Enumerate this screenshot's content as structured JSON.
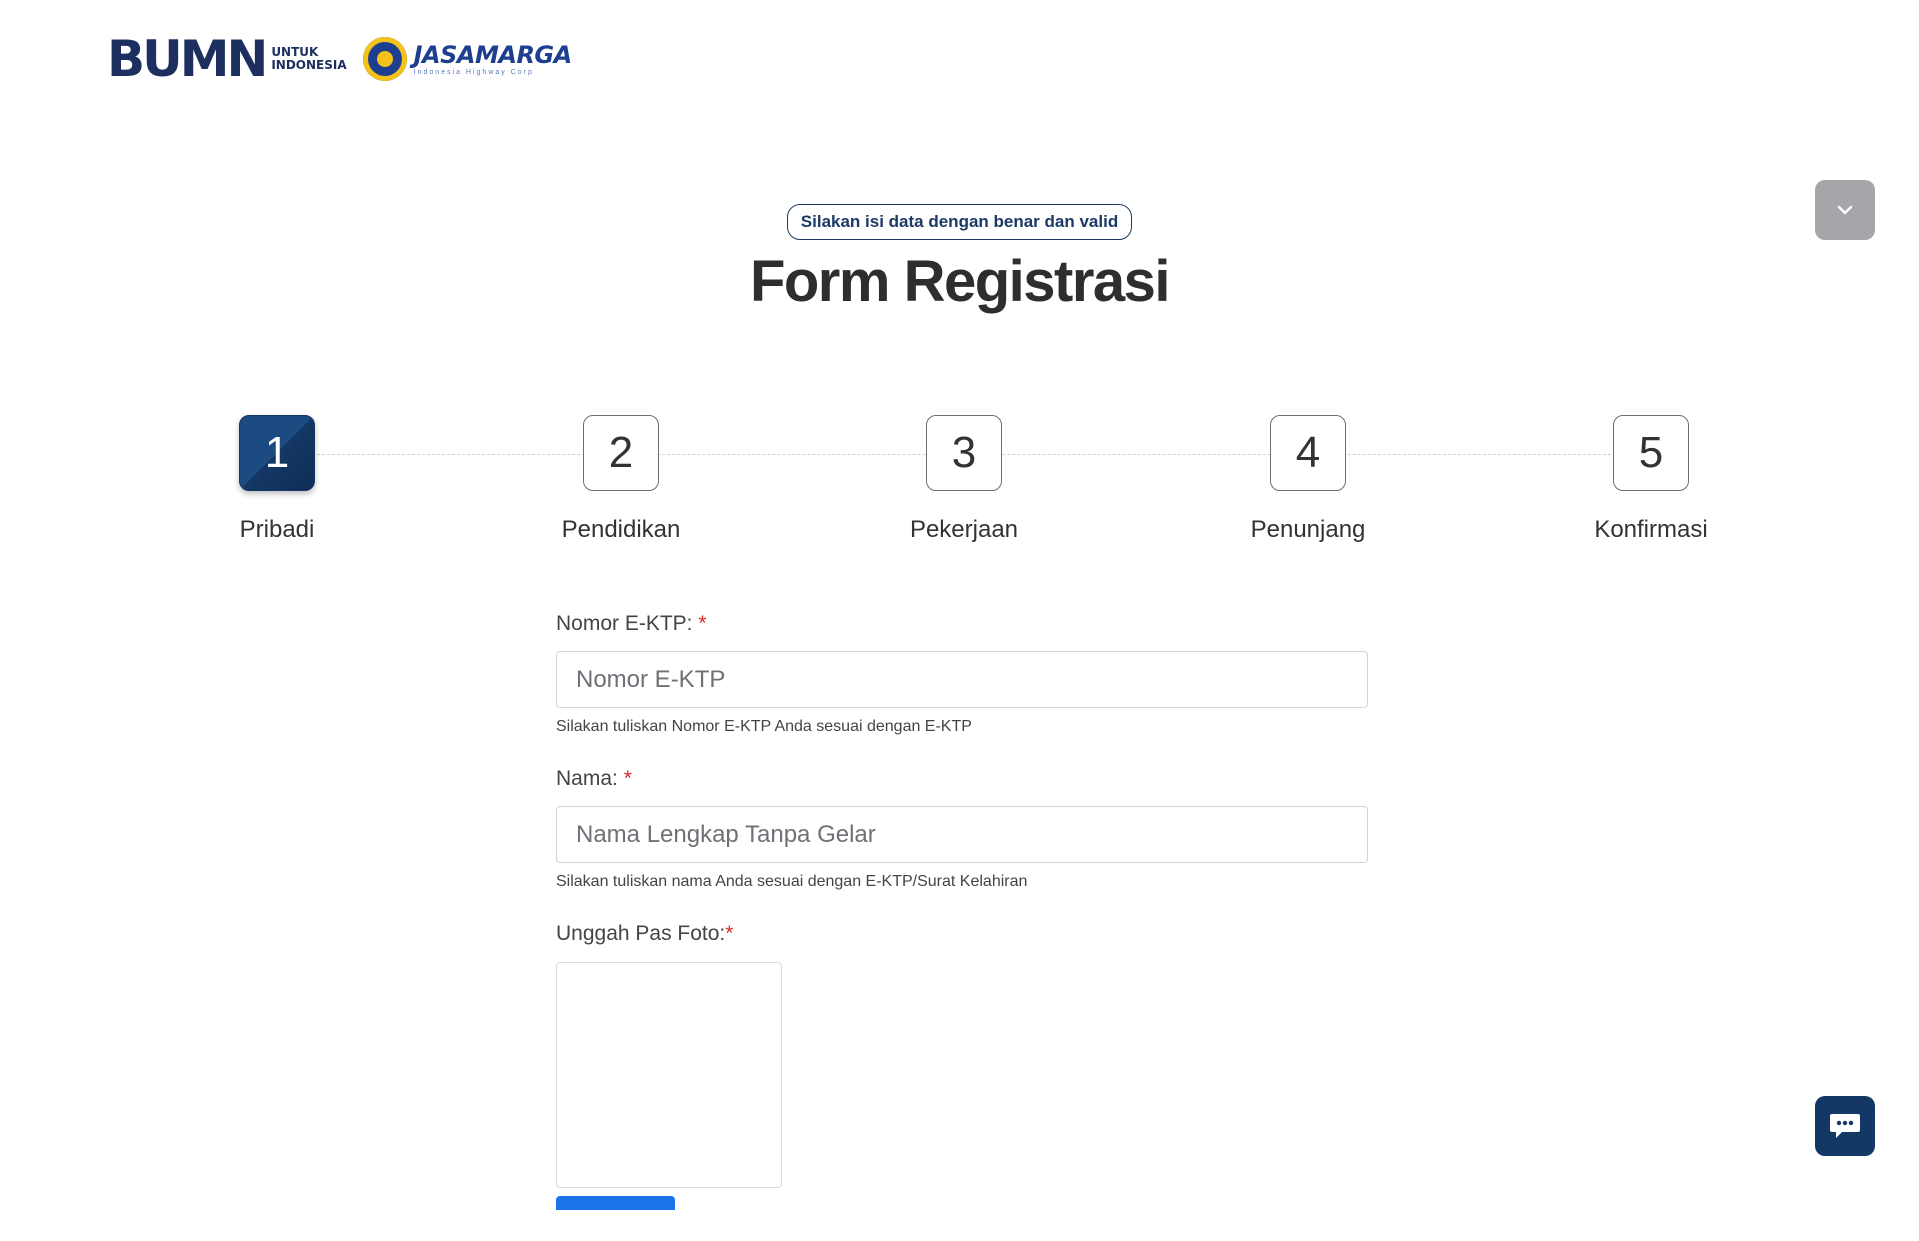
{
  "header": {
    "bumn_mark": "BUMN",
    "bumn_sub_line1": "UNTUK",
    "bumn_sub_line2": "INDONESIA",
    "jm_name": "JASAMARGA",
    "jm_tagline": "Indonesia Highway Corp"
  },
  "hero": {
    "badge": "Silakan isi data dengan benar dan valid",
    "title": "Form Registrasi"
  },
  "steps": [
    {
      "number": "1",
      "label": "Pribadi",
      "active": true
    },
    {
      "number": "2",
      "label": "Pendidikan",
      "active": false
    },
    {
      "number": "3",
      "label": "Pekerjaan",
      "active": false
    },
    {
      "number": "4",
      "label": "Penunjang",
      "active": false
    },
    {
      "number": "5",
      "label": "Konfirmasi",
      "active": false
    }
  ],
  "form": {
    "ktp": {
      "label": "Nomor E-KTP:",
      "required_mark": "*",
      "placeholder": "Nomor E-KTP",
      "value": "",
      "help": "Silakan tuliskan Nomor E-KTP Anda sesuai dengan E-KTP"
    },
    "nama": {
      "label": "Nama:",
      "required_mark": "*",
      "placeholder": "Nama Lengkap Tanpa Gelar",
      "value": "",
      "help": "Silakan tuliskan nama Anda sesuai dengan E-KTP/Surat Kelahiran"
    },
    "foto": {
      "label": "Unggah Pas Foto:",
      "required_mark": "*"
    }
  },
  "icons": {
    "collapse": "chevron-down-icon",
    "chat": "chat-icon"
  },
  "colors": {
    "primary": "#143865",
    "required": "#d62b2b",
    "collapse_button": "#a4a6aa",
    "upload_accent": "#1a73e8"
  }
}
